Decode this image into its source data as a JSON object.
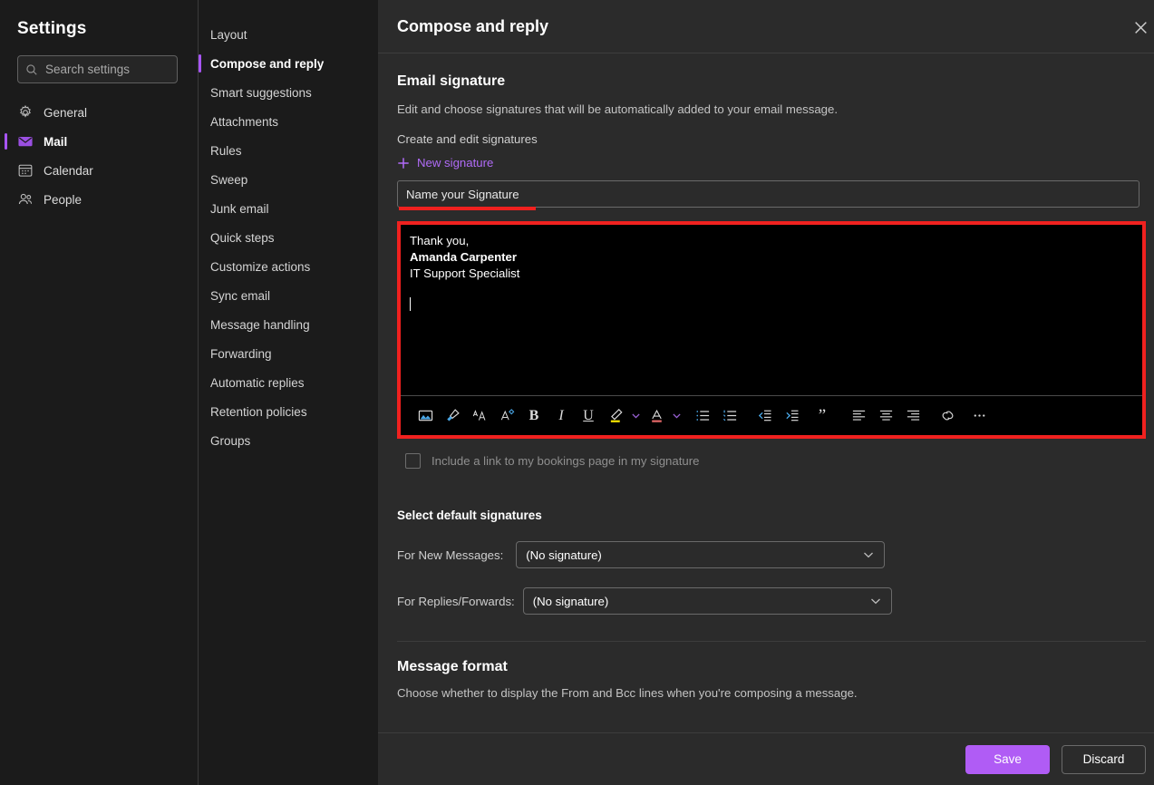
{
  "sidebar": {
    "title": "Settings",
    "search": {
      "placeholder": "Search settings",
      "value": ""
    },
    "items": [
      {
        "label": "General",
        "icon": "gear-icon",
        "selected": false
      },
      {
        "label": "Mail",
        "icon": "mail-icon",
        "selected": true
      },
      {
        "label": "Calendar",
        "icon": "calendar-icon",
        "selected": false
      },
      {
        "label": "People",
        "icon": "people-icon",
        "selected": false
      }
    ]
  },
  "subnav": {
    "items": [
      {
        "label": "Layout",
        "selected": false
      },
      {
        "label": "Compose and reply",
        "selected": true
      },
      {
        "label": "Smart suggestions",
        "selected": false
      },
      {
        "label": "Attachments",
        "selected": false
      },
      {
        "label": "Rules",
        "selected": false
      },
      {
        "label": "Sweep",
        "selected": false
      },
      {
        "label": "Junk email",
        "selected": false
      },
      {
        "label": "Quick steps",
        "selected": false
      },
      {
        "label": "Customize actions",
        "selected": false
      },
      {
        "label": "Sync email",
        "selected": false
      },
      {
        "label": "Message handling",
        "selected": false
      },
      {
        "label": "Forwarding",
        "selected": false
      },
      {
        "label": "Automatic replies",
        "selected": false
      },
      {
        "label": "Retention policies",
        "selected": false
      },
      {
        "label": "Groups",
        "selected": false
      }
    ]
  },
  "header": {
    "title": "Compose and reply",
    "close_label": "Close"
  },
  "email_signature": {
    "section_title": "Email signature",
    "description": "Edit and choose signatures that will be automatically added to your email message.",
    "create_label": "Create and edit signatures",
    "new_signature_label": "New signature",
    "name_input": {
      "placeholder": "Name your Signature",
      "value": ""
    },
    "body_lines": [
      {
        "text": "Thank you,",
        "bold": false
      },
      {
        "text": "Amanda Carpenter",
        "bold": true
      },
      {
        "text": "IT Support Specialist",
        "bold": false
      }
    ],
    "toolbar": [
      {
        "name": "insert-picture-icon",
        "title": "Insert picture"
      },
      {
        "name": "format-painter-icon",
        "title": "Format painter"
      },
      {
        "name": "increase-font-size-icon",
        "title": "Increase font size"
      },
      {
        "name": "decrease-font-size-icon",
        "title": "Decrease font size"
      },
      {
        "name": "bold-icon",
        "title": "Bold"
      },
      {
        "name": "italic-icon",
        "title": "Italic"
      },
      {
        "name": "underline-icon",
        "title": "Underline"
      },
      {
        "name": "highlight-color-icon",
        "title": "Highlight"
      },
      {
        "name": "font-color-icon",
        "title": "Font color"
      },
      {
        "name": "bulleted-list-icon",
        "title": "Bulleted list"
      },
      {
        "name": "numbered-list-icon",
        "title": "Numbered list"
      },
      {
        "name": "decrease-indent-icon",
        "title": "Decrease indent"
      },
      {
        "name": "increase-indent-icon",
        "title": "Increase indent"
      },
      {
        "name": "quote-icon",
        "title": "Quote"
      },
      {
        "name": "align-left-icon",
        "title": "Align left"
      },
      {
        "name": "align-center-icon",
        "title": "Align center"
      },
      {
        "name": "align-right-icon",
        "title": "Align right"
      },
      {
        "name": "insert-link-icon",
        "title": "Insert link"
      },
      {
        "name": "more-options-icon",
        "title": "More options"
      }
    ],
    "bookings_checkbox": {
      "label": "Include a link to my bookings page in my signature",
      "checked": false
    }
  },
  "default_signatures": {
    "title": "Select default signatures",
    "new_messages": {
      "label": "For New Messages:",
      "value": "(No signature)"
    },
    "replies": {
      "label": "For Replies/Forwards:",
      "value": "(No signature)"
    }
  },
  "message_format": {
    "title": "Message format",
    "description": "Choose whether to display the From and Bcc lines when you're composing a message."
  },
  "footer": {
    "save_label": "Save",
    "discard_label": "Discard"
  },
  "colors": {
    "accent_purple": "#a855f7",
    "save_purple": "#b05cf5",
    "highlight_red": "#f0211f",
    "panel_bg": "#2b2b2b",
    "sidebar_bg": "#1b1b1b",
    "editor_bg": "#000000",
    "highlight_yellow": "#f5e400",
    "font_color_red": "#e06666"
  }
}
